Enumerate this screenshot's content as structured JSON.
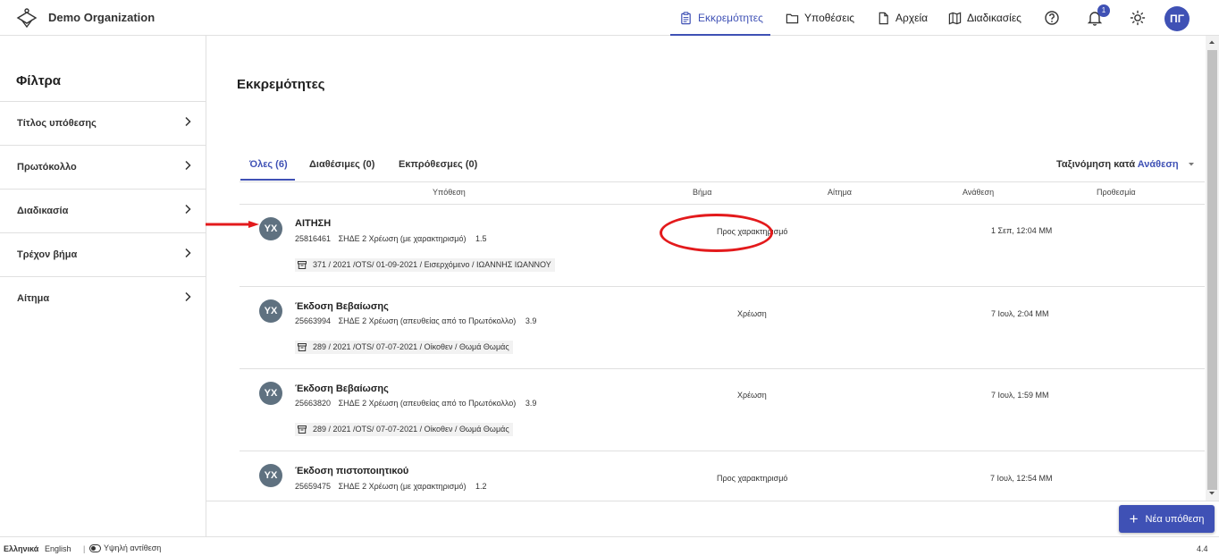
{
  "app": {
    "org_name": "Demo Organization"
  },
  "nav": {
    "pending": "Εκκρεμότητες",
    "cases": "Υποθέσεις",
    "files": "Αρχεία",
    "procedures": "Διαδικασίες",
    "notification_count": "1",
    "user_initials": "ΠΓ"
  },
  "sidebar": {
    "title": "Φίλτρα",
    "filters": [
      {
        "label": "Τίτλος υπόθεσης"
      },
      {
        "label": "Πρωτόκολλο"
      },
      {
        "label": "Διαδικασία"
      },
      {
        "label": "Τρέχον βήμα"
      },
      {
        "label": "Αίτημα"
      }
    ]
  },
  "main": {
    "title": "Εκκρεμότητες",
    "tabs": [
      {
        "label": "Όλες (6)"
      },
      {
        "label": "Διαθέσιμες (0)"
      },
      {
        "label": "Εκπρόθεσμες (0)"
      }
    ],
    "sort": {
      "label": "Ταξινόμηση κατά",
      "value": "Ανάθεση"
    },
    "columns": {
      "case": "Υπόθεση",
      "step": "Βήμα",
      "request": "Αίτημα",
      "assignment": "Ανάθεση",
      "deadline": "Προθεσμία"
    },
    "rows": [
      {
        "avatar": "ΥΧ",
        "title": "ΑΙΤΗΣΗ",
        "code": "25816461",
        "procedure": "ΣΗΔΕ 2 Χρέωση (με χαρακτηρισμό)",
        "version": "1.5",
        "tag": "371 / 2021 /OTS/ 01-09-2021 / Εισερχόμενο / ΙΩΑΝΝΗΣ ΙΩΑΝΝΟΥ",
        "step": "Προς χαρακτηρισμό",
        "date": "1 Σεπ, 12:04 ΜΜ"
      },
      {
        "avatar": "ΥΧ",
        "title": "Έκδοση Βεβαίωσης",
        "code": "25663994",
        "procedure": "ΣΗΔΕ 2 Χρέωση (απευθείας από το Πρωτόκολλο)",
        "version": "3.9",
        "tag": "289 / 2021 /OTS/ 07-07-2021 / Οίκοθεν / Θωμά Θωμάς",
        "step": "Χρέωση",
        "date": "7 Ιουλ, 2:04 ΜΜ"
      },
      {
        "avatar": "ΥΧ",
        "title": "Έκδοση Βεβαίωσης",
        "code": "25663820",
        "procedure": "ΣΗΔΕ 2 Χρέωση (απευθείας από το Πρωτόκολλο)",
        "version": "3.9",
        "tag": "289 / 2021 /OTS/ 07-07-2021 / Οίκοθεν / Θωμά Θωμάς",
        "step": "Χρέωση",
        "date": "7 Ιουλ, 1:59 ΜΜ"
      },
      {
        "avatar": "ΥΧ",
        "title": "Έκδοση πιστοποιητικού",
        "code": "25659475",
        "procedure": "ΣΗΔΕ 2 Χρέωση (με χαρακτηρισμό)",
        "version": "1.2",
        "tag": "",
        "step": "Προς χαρακτηρισμό",
        "date": "7 Ιουλ, 12:54 ΜΜ"
      }
    ]
  },
  "actions": {
    "new_case": "Νέα υπόθεση"
  },
  "footer": {
    "lang_el": "Ελληνικά",
    "lang_en": "English",
    "high_contrast": "Υψηλή αντίθεση",
    "version": "4.4"
  },
  "colors": {
    "primary": "#3f51b5",
    "avatar": "#5f7180",
    "annotation": "#e31a1c"
  }
}
